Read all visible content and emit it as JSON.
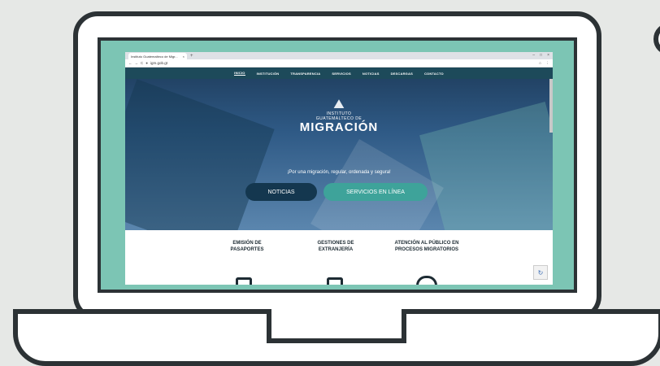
{
  "browser": {
    "tab_title": "Instituto Guatemalteco de Migr...",
    "tab_close": "×",
    "new_tab": "+",
    "window_controls": [
      "–",
      "□",
      "×"
    ],
    "nav_controls": [
      "←",
      "→",
      "C"
    ],
    "url": "igm.gob.gt",
    "addr_icons": [
      "☆",
      "⋮"
    ]
  },
  "nav": {
    "items": [
      "INICIO",
      "INSTITUCIÓN",
      "TRANSPARENCIA",
      "SERVICIOS",
      "NOTICIAS",
      "DESCARGAS",
      "CONTACTO"
    ]
  },
  "logo": {
    "line1": "INSTITUTO",
    "line2": "GUATEMALTECO DE",
    "line3": "MIGRACIÓN"
  },
  "hero": {
    "tagline": "¡Por una migración, regular, ordenada y segura!",
    "btn_noticias": "NOTICIAS",
    "btn_servicios": "SERVICIOS EN LÍNEA"
  },
  "services": [
    {
      "title1": "EMISIÓN DE",
      "title2": "PASAPORTES"
    },
    {
      "title1": "GESTIONES DE",
      "title2": "EXTRANJERÍA"
    },
    {
      "title1": "ATENCIÓN AL PÚBLICO EN",
      "title2": "PROCESOS MIGRATORIOS"
    }
  ],
  "colors": {
    "screen_border": "#7cc5b4",
    "nav": "#1d4a5a",
    "btn_dark": "#14374f",
    "btn_teal": "#3ea39a"
  }
}
